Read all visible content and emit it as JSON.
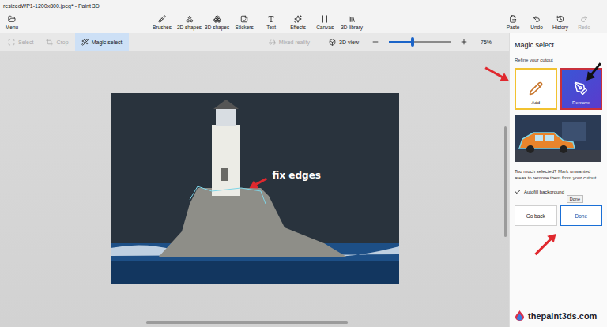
{
  "window": {
    "title": "resizedWP1-1200x800.jpeg* - Paint 3D"
  },
  "menu": {
    "label": "Menu"
  },
  "tools": [
    {
      "label": "Brushes"
    },
    {
      "label": "2D shapes"
    },
    {
      "label": "3D shapes"
    },
    {
      "label": "Stickers"
    },
    {
      "label": "Text"
    },
    {
      "label": "Effects"
    },
    {
      "label": "Canvas"
    },
    {
      "label": "3D library"
    }
  ],
  "actions": [
    {
      "label": "Paste",
      "disabled": false
    },
    {
      "label": "Undo",
      "disabled": false
    },
    {
      "label": "History",
      "disabled": false
    },
    {
      "label": "Redo",
      "disabled": true
    }
  ],
  "modes": [
    {
      "label": "Select",
      "disabled": true,
      "selected": false
    },
    {
      "label": "Crop",
      "disabled": true,
      "selected": false
    },
    {
      "label": "Magic select",
      "disabled": false,
      "selected": true
    }
  ],
  "view": {
    "mixed_reality": {
      "label": "Mixed reality",
      "disabled": true
    },
    "view_3d": {
      "label": "3D view",
      "disabled": false
    },
    "zoom": {
      "reading": "75%",
      "level": 0.38
    }
  },
  "panel": {
    "title": "Magic select",
    "subtitle": "Refine your cutout",
    "options": [
      {
        "label": "Add",
        "selected": false,
        "color": "#f2c230"
      },
      {
        "label": "Remove",
        "selected": true,
        "color": "#c8303c"
      }
    ],
    "hint": "Too much selected? Mark unwanted areas to remove them from your cutout.",
    "autofill": {
      "label": "Autofill background",
      "checked": true
    },
    "tooltip": "Done",
    "buttons": [
      {
        "label": "Go back",
        "kind": "secondary"
      },
      {
        "label": "Done",
        "kind": "primary"
      }
    ]
  },
  "annotation": {
    "label": "fix edges",
    "arrows": {
      "canvas": "#e0282e",
      "add": "#e0282e",
      "remove": "#111111",
      "done": "#e0282e"
    }
  },
  "watermark": {
    "label": "thepaint3ds.com"
  }
}
